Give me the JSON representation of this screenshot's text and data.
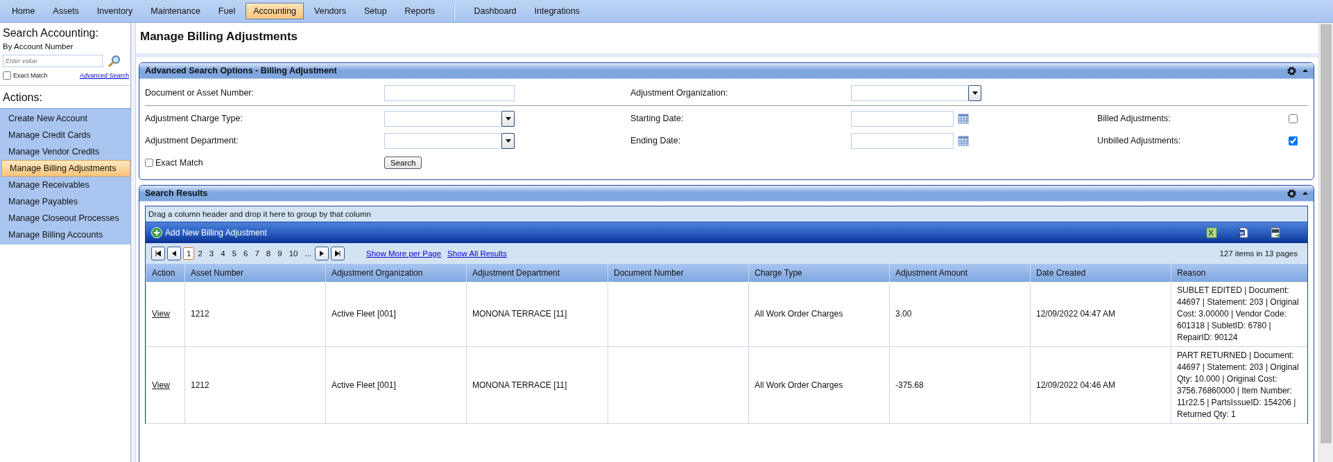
{
  "menu": [
    {
      "label": "Home",
      "selected": false
    },
    {
      "label": "Assets",
      "selected": false
    },
    {
      "label": "Inventory",
      "selected": false
    },
    {
      "label": "Maintenance",
      "selected": false
    },
    {
      "label": "Fuel",
      "selected": false
    },
    {
      "label": "Accounting",
      "selected": true
    },
    {
      "label": "Vendors",
      "selected": false
    },
    {
      "label": "Setup",
      "selected": false
    },
    {
      "label": "Reports",
      "selected": false
    }
  ],
  "menu_right": [
    {
      "label": "Dashboard",
      "selected": false
    },
    {
      "label": "Integrations",
      "selected": false
    }
  ],
  "sidebar": {
    "search_title": "Search Accounting:",
    "search_by": "By Account Number",
    "placeholder": "Enter value",
    "exact_match": {
      "label": "Exact Match",
      "checked": false
    },
    "advanced_link": "Advanced Search",
    "actions_title": "Actions:",
    "actions": [
      {
        "label": "Create New Account",
        "selected": false
      },
      {
        "label": "Manage Credit Cards",
        "selected": false
      },
      {
        "label": "Manage Vendor Credits",
        "selected": false
      },
      {
        "label": "Manage Billing Adjustments",
        "selected": true
      },
      {
        "label": "Manage Receivables",
        "selected": false
      },
      {
        "label": "Manage Payables",
        "selected": false
      },
      {
        "label": "Manage Closeout Processes",
        "selected": false
      },
      {
        "label": "Manage Billing Accounts",
        "selected": false
      }
    ]
  },
  "page_title": "Manage Billing Adjustments",
  "search_panel": {
    "title": "Advanced Search Options - Billing Adjustment",
    "document_label": "Document or Asset Number:",
    "organization_label": "Adjustment Organization:",
    "charge_type_label": "Adjustment Charge Type:",
    "starting_date_label": "Starting Date:",
    "billed": {
      "label": "Billed Adjustments:",
      "checked": false
    },
    "department_label": "Adjustment Department:",
    "ending_date_label": "Ending Date:",
    "unbilled": {
      "label": "Unbilled Adjustments:",
      "checked": true
    },
    "exact_match": {
      "label": "Exact Match",
      "checked": false
    },
    "search_button": "Search"
  },
  "results": {
    "title": "Search Results",
    "group_hint": "Drag a column header and drop it here to group by that column",
    "add_button": "Add New Billing Adjustment",
    "pages": [
      {
        "label": "1",
        "selected": true
      },
      {
        "label": "2",
        "selected": false
      },
      {
        "label": "3",
        "selected": false
      },
      {
        "label": "4",
        "selected": false
      },
      {
        "label": "5",
        "selected": false
      },
      {
        "label": "6",
        "selected": false
      },
      {
        "label": "7",
        "selected": false
      },
      {
        "label": "8",
        "selected": false
      },
      {
        "label": "9",
        "selected": false
      },
      {
        "label": "10",
        "selected": false
      },
      {
        "label": "...",
        "selected": false
      }
    ],
    "show_more": "Show More per Page",
    "show_all": "Show All Results",
    "summary": "127 items in 13 pages",
    "columns": [
      "Action",
      "Asset Number",
      "Adjustment Organization",
      "Adjustment Department",
      "Document Number",
      "Charge Type",
      "Adjustment Amount",
      "Date Created",
      "Reason"
    ],
    "rows": [
      {
        "action": "View",
        "asset_number": "1212",
        "organization": "Active Fleet [001]",
        "department": "MONONA TERRACE [11]",
        "charge_type": "All Work Order Charges",
        "amount": "3.00",
        "date_created": "12/09/2022 04:47 AM",
        "reason": "SUBLET EDITED | Document: 44697 | Statement: 203 | Original Cost: 3.00000 | Vendor Code: 601318 | SubletID: 6780 | RepairID: 90124"
      },
      {
        "action": "View",
        "asset_number": "1212",
        "organization": "Active Fleet [001]",
        "department": "MONONA TERRACE [11]",
        "charge_type": "All Work Order Charges",
        "amount": "-375.68",
        "date_created": "12/09/2022 04:46 AM",
        "reason": "PART RETURNED | Document: 44697 | Statement: 203 | Original Qty: 10.000 | Original Cost: 3756.76860000 | Item Number: 11r22.5 | PartsIssueID: 154206 | Returned Qty: 1"
      }
    ]
  }
}
